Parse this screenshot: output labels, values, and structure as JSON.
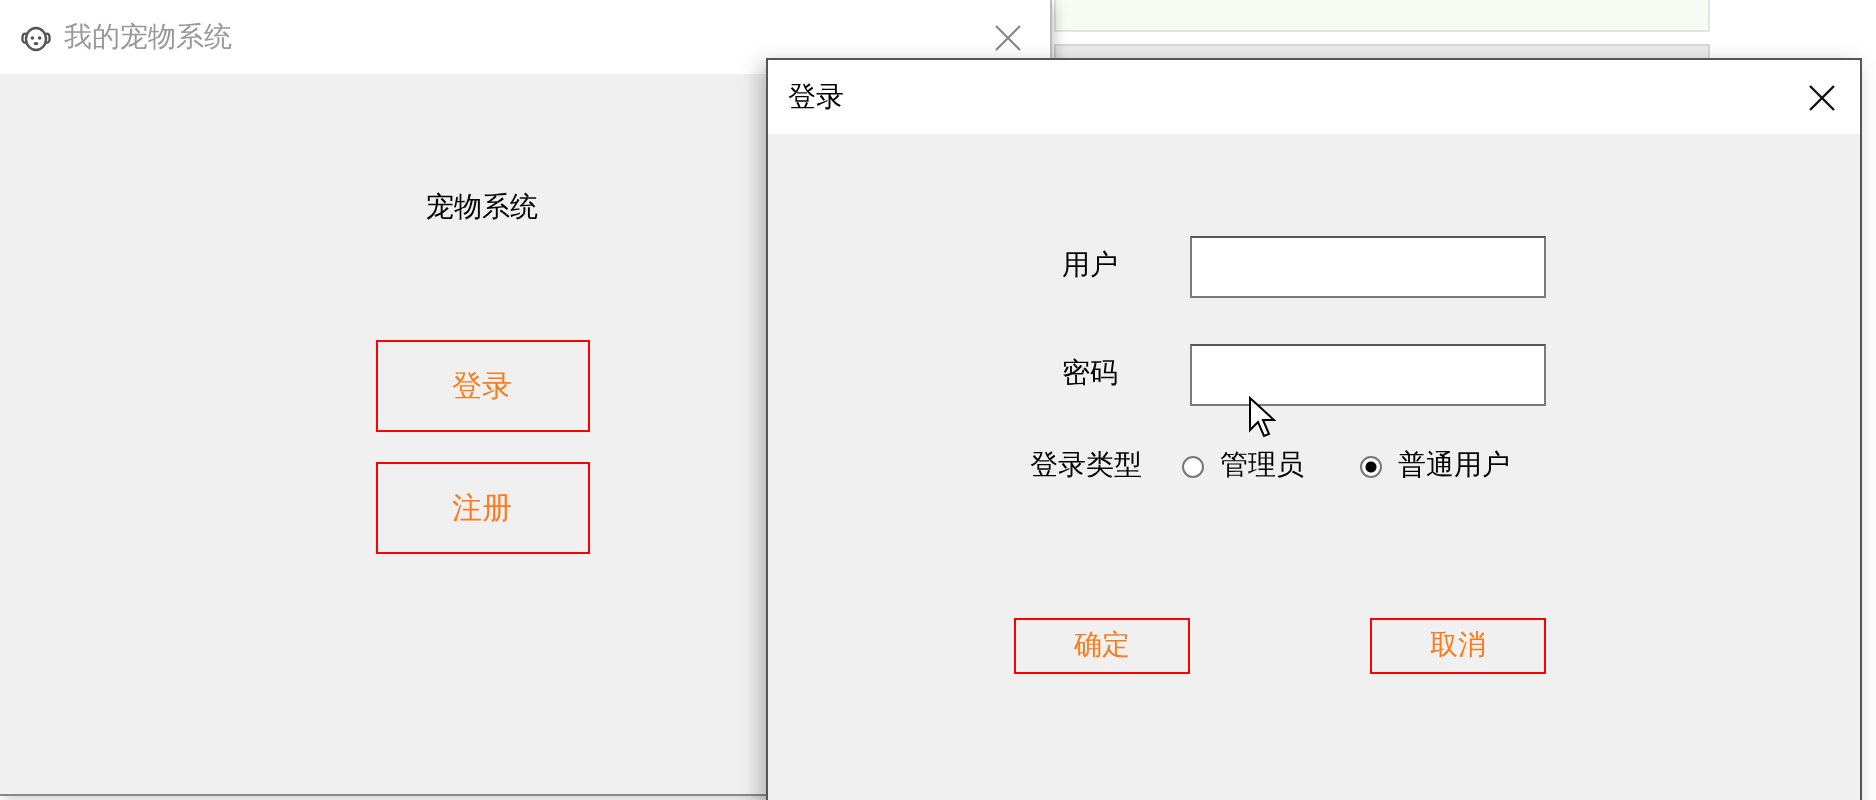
{
  "main_window": {
    "title": "我的宠物系统",
    "heading": "宠物系统",
    "buttons": [
      "登录",
      "注册"
    ]
  },
  "login_dialog": {
    "title": "登录",
    "fields": [
      {
        "label": "用户"
      },
      {
        "label": "密码"
      }
    ],
    "login_type": {
      "label": "登录类型",
      "options": [
        {
          "label": "管理员",
          "selected": false
        },
        {
          "label": "普通用户",
          "selected": true
        }
      ]
    },
    "buttons": [
      "确定",
      "取消"
    ]
  }
}
